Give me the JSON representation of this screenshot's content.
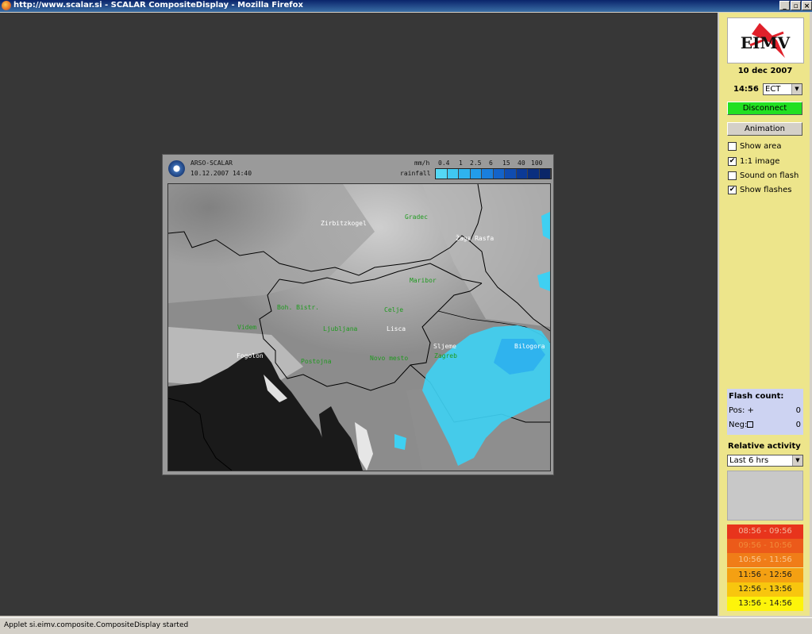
{
  "window": {
    "title": "http://www.scalar.si - SCALAR CompositeDisplay - Mozilla Firefox",
    "controls": [
      "_",
      "▫",
      "×"
    ]
  },
  "status_bar": {
    "text": "Applet si.eimv.composite.CompositeDisplay started"
  },
  "map_panel": {
    "source": "ARSO-SCALAR",
    "datetime": "10.12.2007 14:40",
    "unit": "mm/h",
    "scale_values": [
      "0.4",
      "1",
      "2.5",
      "6",
      "15",
      "40",
      "100"
    ],
    "scale_label": "rainfall",
    "scale_colors": [
      "#54d8f5",
      "#40c8f2",
      "#2fb3ee",
      "#229cea",
      "#1a7fdd",
      "#1463c9",
      "#104cb0",
      "#0c3a96",
      "#0a2f7f",
      "#0a2668"
    ],
    "cities": [
      {
        "name": "Zirbitzkogel",
        "color": "#ffffff"
      },
      {
        "name": "Gradec",
        "color": "#1f9a1f"
      },
      {
        "name": "Žaga Rasfa",
        "color": "#ffffff"
      },
      {
        "name": "Maribor",
        "color": "#1f9a1f"
      },
      {
        "name": "Boh. Bistr.",
        "color": "#1f9a1f"
      },
      {
        "name": "Celje",
        "color": "#1f9a1f"
      },
      {
        "name": "Videm",
        "color": "#1f9a1f"
      },
      {
        "name": "Ljubljana",
        "color": "#1f9a1f"
      },
      {
        "name": "Lisca",
        "color": "#ffffff"
      },
      {
        "name": "Sljeme",
        "color": "#ffffff"
      },
      {
        "name": "Bilogora",
        "color": "#ffffff"
      },
      {
        "name": "Fogolon",
        "color": "#ffffff"
      },
      {
        "name": "Postojna",
        "color": "#1f9a1f"
      },
      {
        "name": "Novo mesto",
        "color": "#1f9a1f"
      },
      {
        "name": "Zagreb",
        "color": "#1f9a1f"
      }
    ]
  },
  "side_panel": {
    "logo_text": "EIMV",
    "date": "10 dec 2007",
    "time": "14:56",
    "timezone": "ECT",
    "disconnect_label": "Disconnect",
    "animation_label": "Animation",
    "options": [
      {
        "label": "Show area",
        "checked": false
      },
      {
        "label": "1:1 image",
        "checked": true
      },
      {
        "label": "Sound on flash",
        "checked": false
      },
      {
        "label": "Show flashes",
        "checked": true
      }
    ],
    "flash_count": {
      "title": "Flash count:",
      "pos_label": "Pos: +",
      "pos_value": "0",
      "neg_label": "Neg:",
      "neg_value": "0"
    },
    "relative_activity_label": "Relative activity",
    "period": "Last 6 hrs",
    "intervals": [
      {
        "label": "08:56 - 09:56",
        "color": "#e8341c",
        "text_color": "#f3b59c"
      },
      {
        "label": "09:56 - 10:56",
        "color": "#ec5a1a",
        "text_color": "#f08a3a"
      },
      {
        "label": "10:56 - 11:56",
        "color": "#f07d18",
        "text_color": "#f9c690"
      },
      {
        "label": "11:56 - 12:56",
        "color": "#f4a012",
        "text_color": "#1a1a1a"
      },
      {
        "label": "12:56 - 13:56",
        "color": "#f8c60e",
        "text_color": "#1a1a1a"
      },
      {
        "label": "13:56 - 14:56",
        "color": "#fdf40a",
        "text_color": "#1a1a1a"
      }
    ],
    "colors": {
      "panel_bg": "#ede58b",
      "disconnect_bg": "#22e022",
      "flash_bg": "#cdd3f2"
    }
  }
}
